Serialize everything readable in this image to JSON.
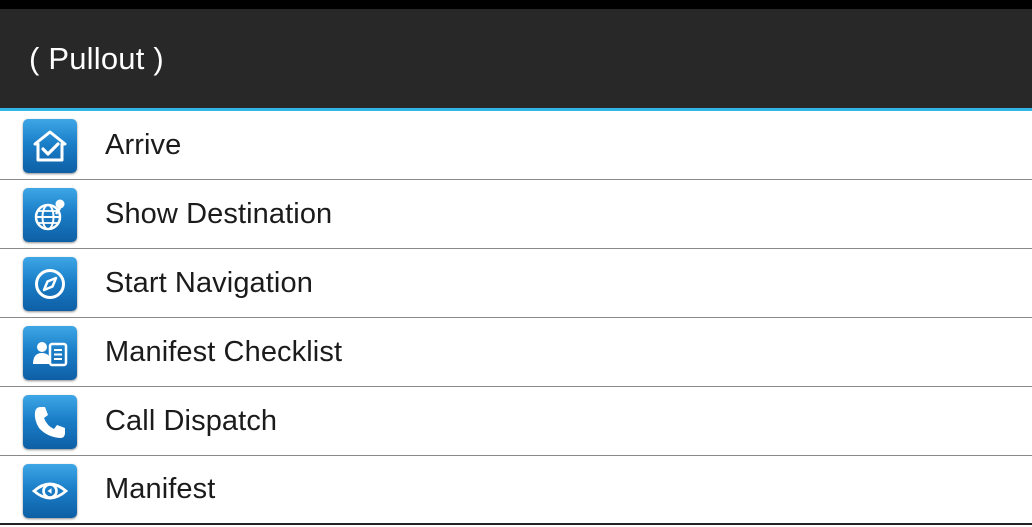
{
  "header": {
    "title": "( Pullout )"
  },
  "colors": {
    "title_bar": "#282828",
    "accent": "#33b5e5",
    "icon_blue": "#1b7fc9"
  },
  "menu": {
    "items": [
      {
        "label": "Arrive",
        "icon": "home-check-icon"
      },
      {
        "label": "Show Destination",
        "icon": "globe-pin-icon"
      },
      {
        "label": "Start Navigation",
        "icon": "compass-icon"
      },
      {
        "label": "Manifest Checklist",
        "icon": "contact-list-icon"
      },
      {
        "label": "Call Dispatch",
        "icon": "phone-icon"
      },
      {
        "label": "Manifest",
        "icon": "eye-icon"
      }
    ]
  }
}
